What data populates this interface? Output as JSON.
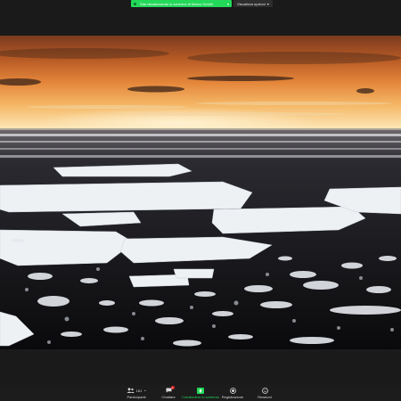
{
  "share_banner": {
    "status_text": "Stai visualizzando lo schermo di Marco Gentili",
    "view_options_label": "Visualizza opzioni",
    "accent_color": "#23d959"
  },
  "shared_screen": {
    "content": "arctic sea ice at sunset photograph"
  },
  "toolbar": {
    "participants": {
      "label": "Partecipanti",
      "count": "161",
      "icon": "participants-icon"
    },
    "chat": {
      "label": "Chattare",
      "badge": "1",
      "icon": "chat-icon"
    },
    "share": {
      "label": "Condividere lo schermo",
      "icon": "share-screen-icon",
      "color": "#23d959"
    },
    "record": {
      "label": "Registrazione",
      "icon": "record-icon"
    },
    "reactions": {
      "label": "Reazioni",
      "icon": "reactions-icon"
    }
  }
}
